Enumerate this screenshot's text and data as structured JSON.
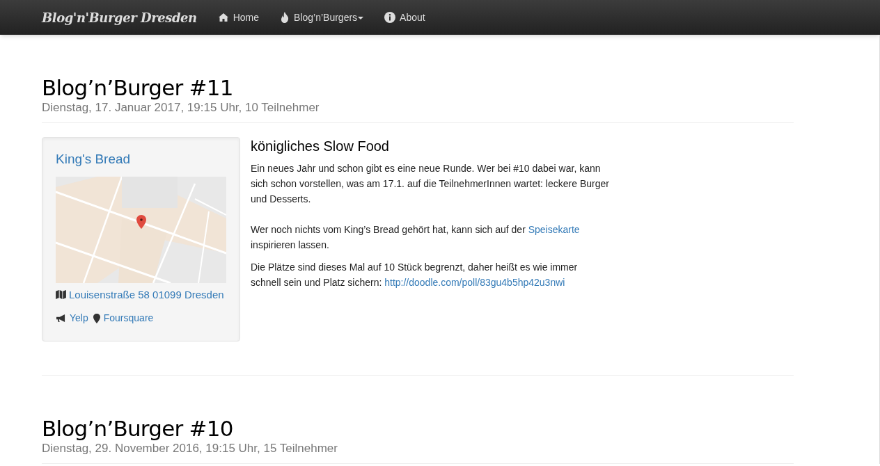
{
  "navbar": {
    "brand": "Blog'n'Burger Dresden",
    "items": [
      {
        "label": "Home",
        "dropdown": false
      },
      {
        "label": "Blog’n’Burgers",
        "dropdown": true
      },
      {
        "label": "About",
        "dropdown": false
      }
    ]
  },
  "events": [
    {
      "title": "Blog’n’Burger #11",
      "subtitle": "Dienstag, 17. Januar 2017, 19:15 Uhr, 10 Teilnehmer",
      "venue": {
        "name": "King's Bread",
        "address": "Louisenstraße 58 01099 Dresden",
        "links": [
          {
            "label": "Yelp"
          },
          {
            "label": "Foursquare"
          }
        ]
      },
      "heading": "königliches Slow Food",
      "paragraphs": [
        [
          {
            "text": "Ein neues Jahr und schon gibt es eine neue Runde. Wer bei #10 dabei war, kann sich schon vorstellen, was am 17.1. auf die TeilnehmerInnen wartet: leckere Burger und Desserts."
          }
        ],
        [
          {
            "text": "Wer noch nichts vom King’s Bread gehört hat, kann sich auf der "
          },
          {
            "link": "Speisekarte"
          },
          {
            "text": " inspirieren lassen."
          }
        ],
        [
          {
            "text": "Die Plätze sind dieses Mal auf 10 Stück begrenzt, daher heißt es wie immer schnell sein und Platz sichern: "
          },
          {
            "link": "http://doodle.com/poll/83gu4b5hp42u3nwi"
          }
        ]
      ]
    },
    {
      "title": "Blog’n’Burger #10",
      "subtitle": "Dienstag, 29. November 2016, 19:15 Uhr, 15 Teilnehmer"
    }
  ]
}
